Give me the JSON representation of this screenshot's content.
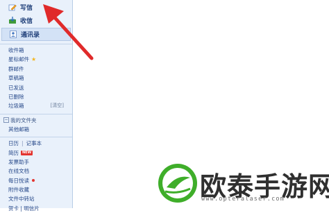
{
  "nav": {
    "compose": "写信",
    "inbox_btn": "收信",
    "contacts": "通讯录"
  },
  "folders": [
    {
      "label": "收件箱"
    },
    {
      "label": "星标邮件"
    },
    {
      "label": "群邮件"
    },
    {
      "label": "草稿箱"
    },
    {
      "label": "已发送"
    },
    {
      "label": "已删除"
    },
    {
      "label": "垃圾箱",
      "action": "[清空]"
    }
  ],
  "my_folders": {
    "header": "我的文件夹",
    "toggle": "⊟",
    "items": [
      "其他邮箱"
    ]
  },
  "tools": {
    "calendar": "日历",
    "notes": "记事本",
    "resume": "简历",
    "new_badge": "NEW",
    "assistant": "发票助手",
    "online_docs": "在线文档",
    "daily_news": "每日悦读",
    "attachments": "附件收藏",
    "file_transfer": "文件中转站",
    "last_partial": "贺卡 | 明信片"
  },
  "watermark": {
    "text": "欧泰手游网",
    "url": "www.opteralaser.com"
  },
  "colors": {
    "sidebar_bg": "#e9f1fb",
    "link": "#27498a",
    "arrow": "#e02a2a",
    "logo_green": "#3fae2a"
  }
}
